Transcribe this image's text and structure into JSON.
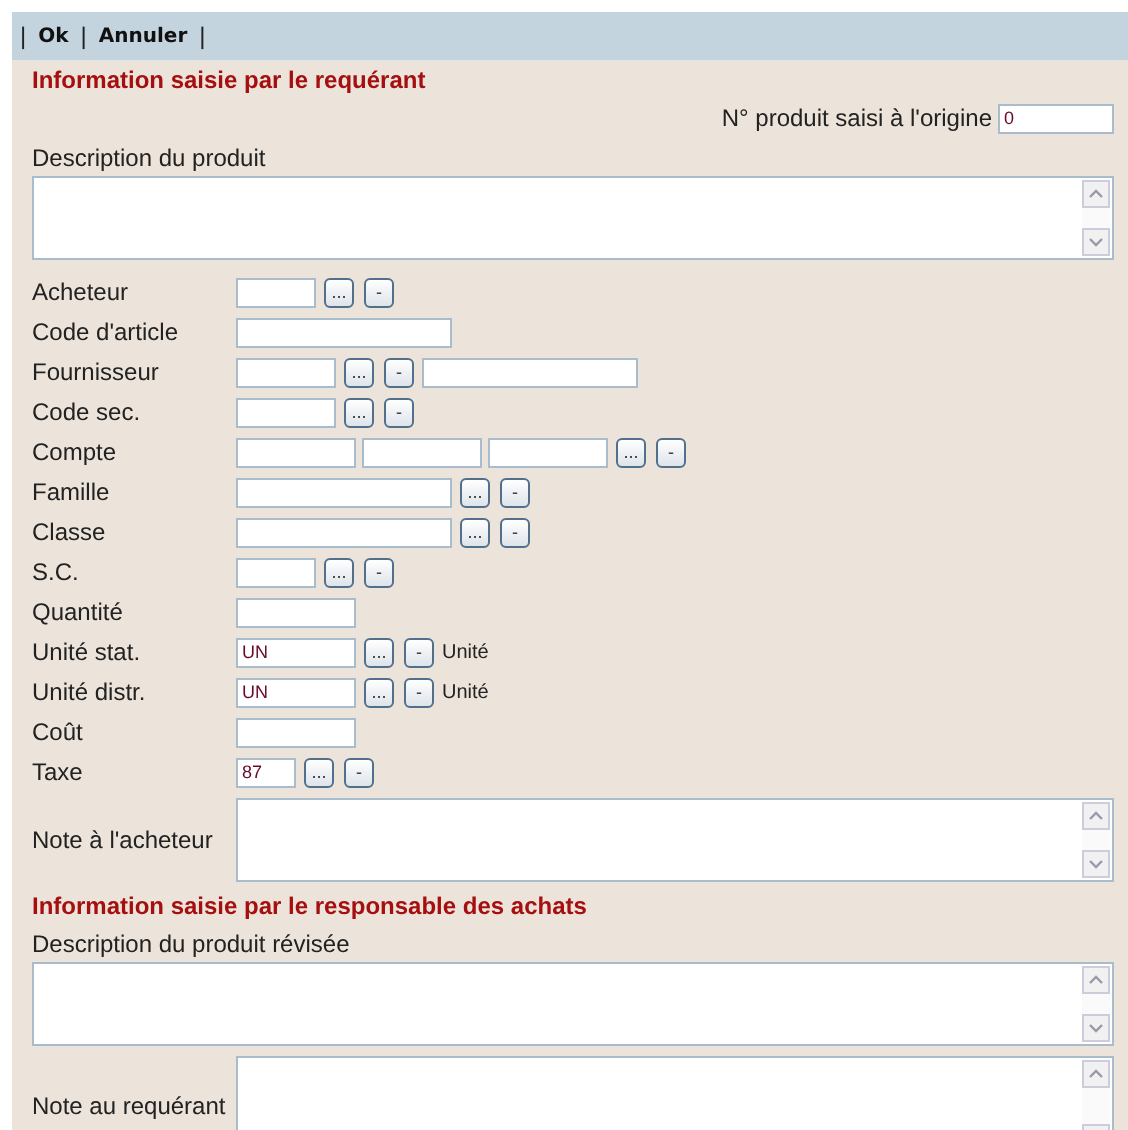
{
  "toolbar": [
    {
      "kind": "separator",
      "text": "|"
    },
    {
      "kind": "button",
      "text": "Ok"
    },
    {
      "kind": "separator",
      "text": "|"
    },
    {
      "kind": "button",
      "text": "Annuler"
    },
    {
      "kind": "separator",
      "text": "|"
    }
  ],
  "section_requester": {
    "title": "Information saisie par le requérant",
    "original_product": {
      "label": "N° produit saisi à l'origine",
      "value": "0"
    },
    "description": {
      "label": "Description du produit"
    },
    "fields": [
      {
        "label": "Acheteur",
        "controls": [
          {
            "kind": "input"
          },
          {
            "kind": "lookup",
            "text": "..."
          },
          {
            "kind": "clear",
            "text": "-"
          }
        ]
      },
      {
        "label": "Code d'article",
        "controls": [
          {
            "kind": "input"
          }
        ]
      },
      {
        "label": "Fournisseur",
        "controls": [
          {
            "kind": "input"
          },
          {
            "kind": "lookup",
            "text": "..."
          },
          {
            "kind": "clear",
            "text": "-"
          },
          {
            "kind": "input"
          }
        ]
      },
      {
        "label": "Code sec.",
        "controls": [
          {
            "kind": "input"
          },
          {
            "kind": "lookup",
            "text": "..."
          },
          {
            "kind": "clear",
            "text": "-"
          }
        ]
      },
      {
        "label": "Compte",
        "controls": [
          {
            "kind": "input"
          },
          {
            "kind": "input"
          },
          {
            "kind": "input"
          },
          {
            "kind": "lookup",
            "text": "..."
          },
          {
            "kind": "clear",
            "text": "-"
          }
        ]
      },
      {
        "label": "Famille",
        "controls": [
          {
            "kind": "input"
          },
          {
            "kind": "lookup",
            "text": "..."
          },
          {
            "kind": "clear",
            "text": "-"
          }
        ]
      },
      {
        "label": "Classe",
        "controls": [
          {
            "kind": "input"
          },
          {
            "kind": "lookup",
            "text": "..."
          },
          {
            "kind": "clear",
            "text": "-"
          }
        ]
      },
      {
        "label": "S.C.",
        "controls": [
          {
            "kind": "input"
          },
          {
            "kind": "lookup",
            "text": "..."
          },
          {
            "kind": "clear",
            "text": "-"
          }
        ]
      },
      {
        "label": "Quantité",
        "controls": [
          {
            "kind": "input"
          }
        ]
      },
      {
        "label": "Unité stat.",
        "controls": [
          {
            "kind": "input",
            "value": "UN"
          },
          {
            "kind": "lookup",
            "text": "..."
          },
          {
            "kind": "clear",
            "text": "-"
          },
          {
            "kind": "note",
            "text": "Unité"
          }
        ]
      },
      {
        "label": "Unité distr.",
        "controls": [
          {
            "kind": "input",
            "value": "UN"
          },
          {
            "kind": "lookup",
            "text": "..."
          },
          {
            "kind": "clear",
            "text": "-"
          },
          {
            "kind": "note",
            "text": "Unité"
          }
        ]
      },
      {
        "label": "Coût",
        "controls": [
          {
            "kind": "input"
          }
        ]
      },
      {
        "label": "Taxe",
        "controls": [
          {
            "kind": "input",
            "value": "87"
          },
          {
            "kind": "lookup",
            "text": "..."
          },
          {
            "kind": "clear",
            "text": "-"
          }
        ]
      }
    ],
    "buyer_note": {
      "label": "Note à l'acheteur"
    }
  },
  "section_purchasing": {
    "title": "Information saisie par le responsable des achats",
    "revised_description": {
      "label": "Description du produit révisée"
    },
    "requester_note": {
      "label": "Note au requérant"
    }
  }
}
